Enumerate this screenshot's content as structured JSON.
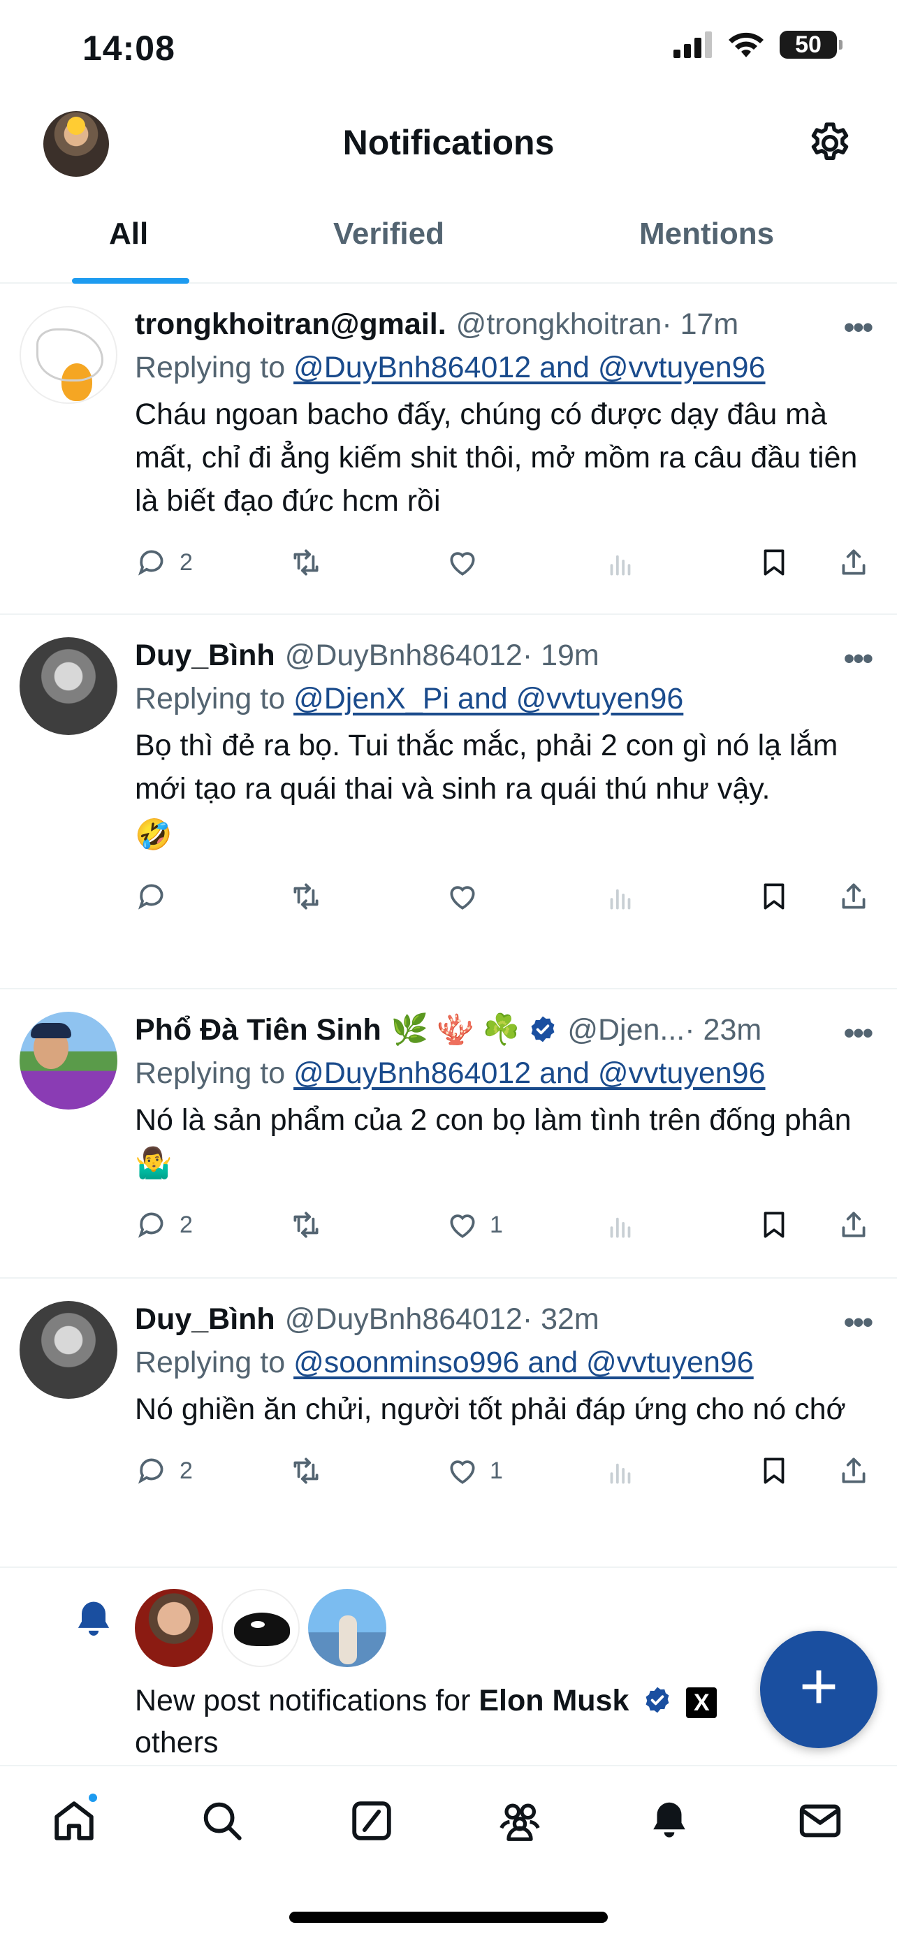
{
  "status_bar": {
    "time": "14:08",
    "battery": "50"
  },
  "header": {
    "title": "Notifications"
  },
  "tabs": [
    {
      "label": "All"
    },
    {
      "label": "Verified"
    },
    {
      "label": "Mentions"
    }
  ],
  "posts": [
    {
      "name": "trongkhoitran@gmail.",
      "handle": "@trongkhoitran",
      "time": "· 17m",
      "replying_prefix": "Replying to ",
      "replying_to": "@DuyBnh864012 and @vvtuyen96",
      "text": "Cháu ngoan bacho đấy, chúng có được dạy đâu mà mất, chỉ đi ẳng kiếm shit thôi, mở mồm ra câu đầu tiên là biết đạo đức hcm rồi",
      "replies": "2",
      "likes": ""
    },
    {
      "name": "Duy_Bình",
      "handle": "@DuyBnh864012",
      "time": "· 19m",
      "replying_prefix": "Replying to ",
      "replying_to": "@DjenX_Pi and @vvtuyen96",
      "text": "Bọ thì đẻ ra bọ. Tui thắc mắc, phải 2 con gì nó lạ lắm mới tạo ra quái thai và sinh ra quái thú như vậy.",
      "emoji": "🤣",
      "replies": "",
      "likes": ""
    },
    {
      "name": "Phổ Đà Tiên Sinh",
      "name_emojis": "🌿 🪸 ☘️",
      "handle": "@Djen...",
      "time": "· 23m",
      "replying_prefix": "Replying to ",
      "replying_to": "@DuyBnh864012 and @vvtuyen96",
      "text": "Nó là sản phẩm của 2 con bọ làm tình trên đống phân 🤷‍♂️",
      "replies": "2",
      "likes": "1"
    },
    {
      "name": "Duy_Bình",
      "handle": "@DuyBnh864012",
      "time": "· 32m",
      "replying_prefix": "Replying to ",
      "replying_to": "@soonminso996 and @vvtuyen96",
      "text": "Nó ghiền ăn chửi, người tốt phải đáp ứng cho nó chớ",
      "replies": "2",
      "likes": "1"
    }
  ],
  "notification": {
    "prefix": "New post notifications for ",
    "name": "Elon Musk",
    "x_badge": "X",
    "suffix": "others"
  },
  "fab": {
    "label": "+"
  },
  "colors": {
    "accent": "#1d9bf0",
    "fab": "#1a4fa0",
    "secondary_text": "#536471"
  }
}
